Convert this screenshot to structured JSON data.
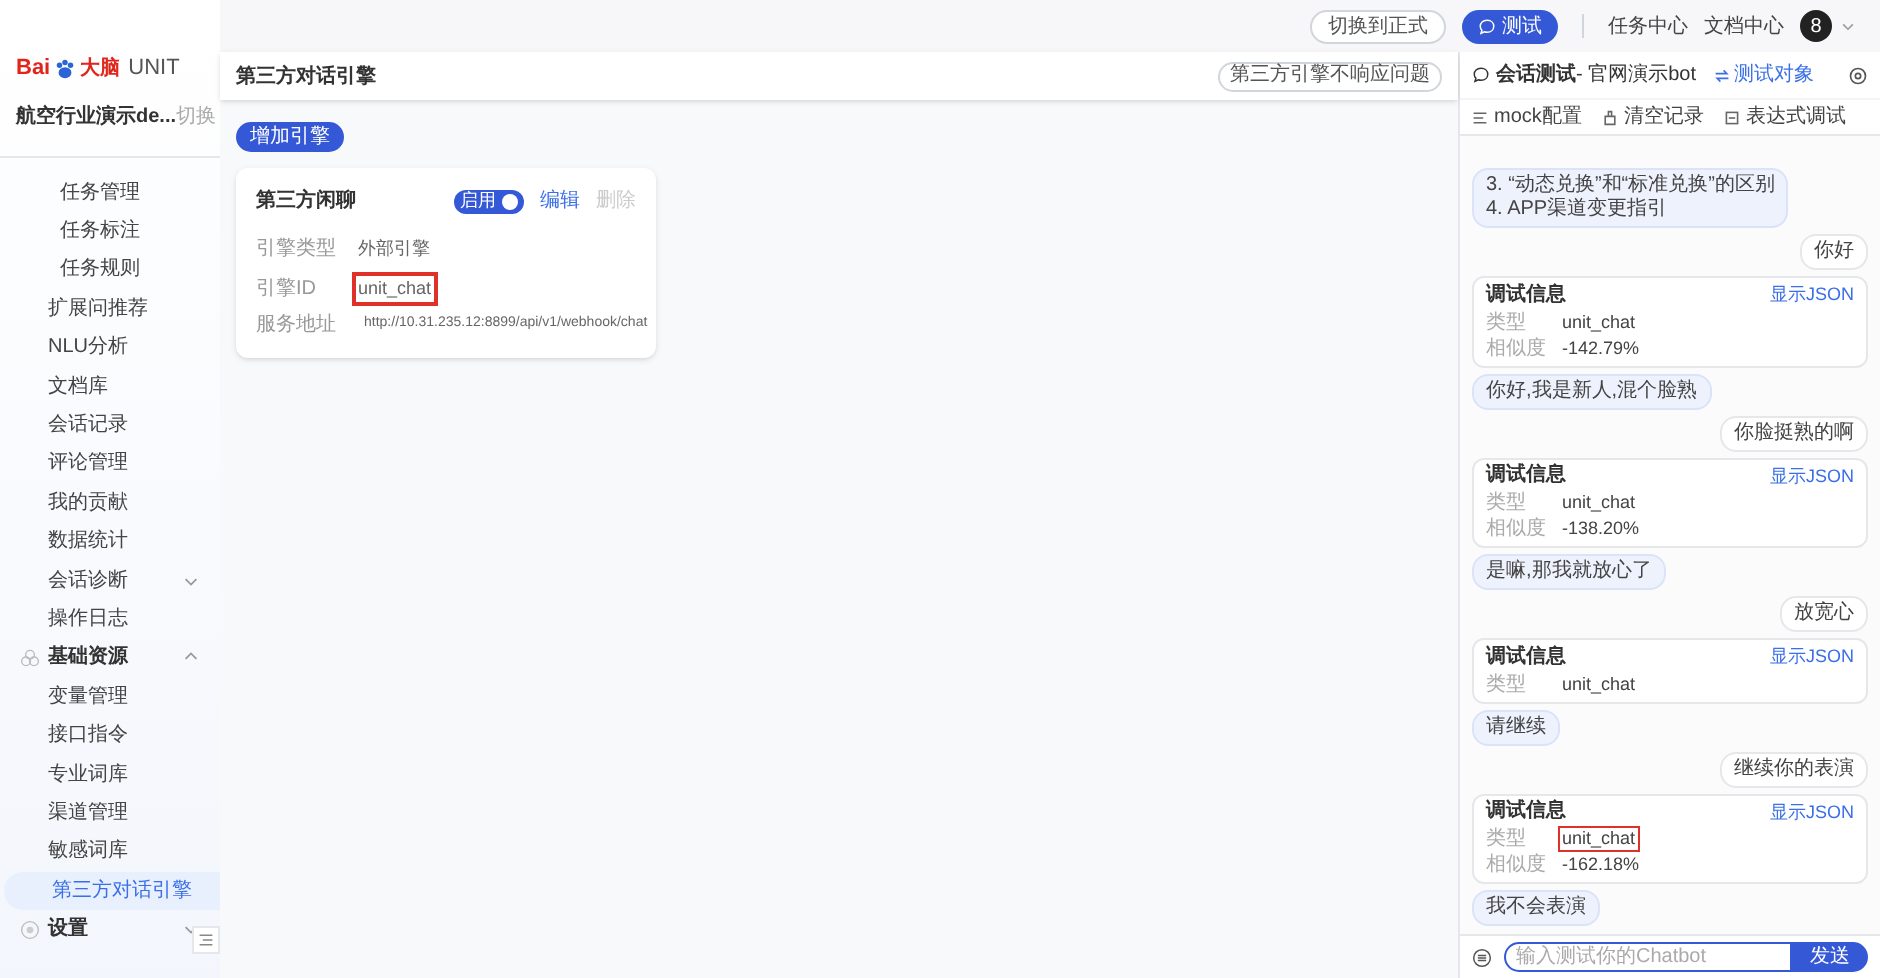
{
  "sidebar": {
    "logo": {
      "brand_latin": "Bai",
      "brand_cn": "大脑",
      "product": "UNIT"
    },
    "project": {
      "name": "航空行业演示de...",
      "switch_label": "切换"
    },
    "items": [
      {
        "kind": "nested",
        "label": "任务管理",
        "selected": false
      },
      {
        "kind": "nested",
        "label": "任务标注",
        "selected": false
      },
      {
        "kind": "nested",
        "label": "任务规则",
        "selected": false
      },
      {
        "kind": "item",
        "label": "扩展问推荐",
        "selected": false
      },
      {
        "kind": "item",
        "label": "NLU分析",
        "selected": false
      },
      {
        "kind": "item",
        "label": "文档库",
        "selected": false
      },
      {
        "kind": "item",
        "label": "会话记录",
        "selected": false
      },
      {
        "kind": "item",
        "label": "评论管理",
        "selected": false
      },
      {
        "kind": "item",
        "label": "我的贡献",
        "selected": false
      },
      {
        "kind": "item",
        "label": "数据统计",
        "selected": false
      },
      {
        "kind": "item",
        "label": "会话诊断",
        "selected": false,
        "expanded": false
      },
      {
        "kind": "item",
        "label": "操作日志",
        "selected": false
      },
      {
        "kind": "group",
        "label": "基础资源",
        "expanded": true,
        "children": [
          {
            "label": "变量管理",
            "selected": false
          },
          {
            "label": "接口指令",
            "selected": false
          },
          {
            "label": "专业词库",
            "selected": false
          },
          {
            "label": "渠道管理",
            "selected": false
          },
          {
            "label": "敏感词库",
            "selected": false
          },
          {
            "label": "第三方对话引擎",
            "selected": true
          }
        ]
      },
      {
        "kind": "group",
        "label": "设置",
        "expanded": false
      }
    ]
  },
  "top_bar": {
    "buttons": [
      {
        "kind": "outline",
        "label": "切换到正式"
      },
      {
        "kind": "primary",
        "label": "测试"
      }
    ],
    "links": [
      "任务中心",
      "文档中心"
    ],
    "avatar": "8"
  },
  "main": {
    "title": "第三方对话引擎",
    "header_button": "第三方引擎不响应问题",
    "add_button": "增加引擎",
    "engine_card": {
      "title": "第三方闲聊",
      "toggle": {
        "label": "启用",
        "on": true
      },
      "actions": [
        {
          "label": "编辑",
          "disabled": false
        },
        {
          "label": "删除",
          "disabled": true
        }
      ],
      "fields": [
        {
          "kind": "text",
          "label": "引擎类型",
          "value": "外部引擎",
          "highlighted": false
        },
        {
          "kind": "text",
          "label": "引擎ID",
          "value": "unit_chat",
          "highlighted": true
        },
        {
          "kind": "list",
          "label": "服务地址",
          "value": "http://10.31.235.12:8899/api/v1/webhook/chat",
          "highlighted": false
        }
      ]
    }
  },
  "chat": {
    "title": "**会话测试**- 官网演示bot",
    "target_link": "测试对象",
    "tools": [
      "mock配置",
      "清空记录",
      "表达式调试"
    ],
    "messages": [
      {
        "kind": "bot",
        "lines": [
          "3. “动态兑换”和“标准兑换”的区别",
          "4. APP渠道变更指引"
        ]
      },
      {
        "kind": "user",
        "text": "你好"
      },
      {
        "kind": "debug",
        "title": "调试信息",
        "link": "显示JSON",
        "fields": [
          {
            "label": "类型",
            "value": "unit_chat",
            "highlighted": false
          },
          {
            "label": "相似度",
            "value": "-142.79%",
            "highlighted": false
          }
        ]
      },
      {
        "kind": "bot",
        "lines": [
          "你好,我是新人,混个脸熟"
        ]
      },
      {
        "kind": "user",
        "text": "你脸挺熟的啊"
      },
      {
        "kind": "debug",
        "title": "调试信息",
        "link": "显示JSON",
        "fields": [
          {
            "label": "类型",
            "value": "unit_chat",
            "highlighted": false
          },
          {
            "label": "相似度",
            "value": "-138.20%",
            "highlighted": false
          }
        ]
      },
      {
        "kind": "bot",
        "lines": [
          "是嘛,那我就放心了"
        ]
      },
      {
        "kind": "user",
        "text": "放宽心"
      },
      {
        "kind": "debug",
        "title": "调试信息",
        "link": "显示JSON",
        "fields": [
          {
            "label": "类型",
            "value": "unit_chat",
            "highlighted": false
          }
        ]
      },
      {
        "kind": "bot",
        "lines": [
          "请继续"
        ]
      },
      {
        "kind": "user",
        "text": "继续你的表演"
      },
      {
        "kind": "debug",
        "title": "调试信息",
        "link": "显示JSON",
        "fields": [
          {
            "label": "类型",
            "value": "unit_chat",
            "highlighted": true
          },
          {
            "label": "相似度",
            "value": "-162.18%",
            "highlighted": false
          }
        ]
      },
      {
        "kind": "bot",
        "lines": [
          "我不会表演"
        ]
      }
    ],
    "input": {
      "placeholder": "输入测试你的Chatbot"
    },
    "send": "发送"
  }
}
